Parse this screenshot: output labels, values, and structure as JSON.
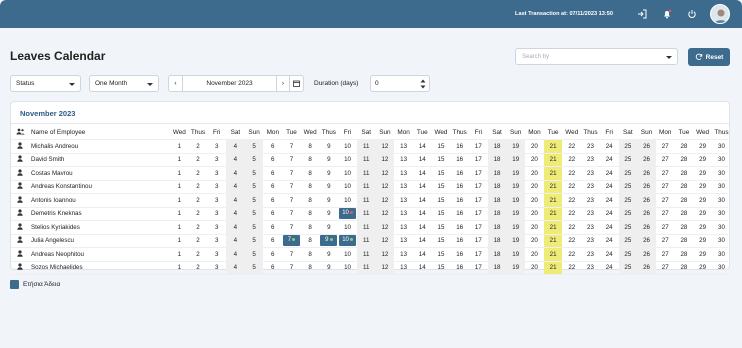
{
  "header": {
    "last_transaction": "Last Transaction at: 07/11/2023 13:50",
    "bg_color": "#3d6b8d"
  },
  "page": {
    "title": "Leaves Calendar"
  },
  "search": {
    "placeholder": "Search by"
  },
  "reset_label": "Reset",
  "filters": {
    "status": "Status",
    "period": "One Month",
    "month": "November 2023",
    "duration_label": "Duration (days)",
    "duration_value": "0"
  },
  "calendar": {
    "title": "November 2023",
    "name_header": "Name of Employee",
    "weekdays": [
      "Wed",
      "Thus",
      "Fri",
      "Sat",
      "Sun",
      "Mon",
      "Tue",
      "Wed",
      "Thus",
      "Fri",
      "Sat",
      "Sun",
      "Mon",
      "Tue",
      "Wed",
      "Thus",
      "Fri",
      "Sat",
      "Sun",
      "Mon",
      "Tue",
      "Wed",
      "Thus",
      "Fri",
      "Sat",
      "Sun",
      "Mon",
      "Tue",
      "Wed",
      "Thus"
    ],
    "weekend_days": [
      4,
      5,
      11,
      12,
      18,
      19,
      25,
      26
    ],
    "today": 21,
    "employees": [
      {
        "name": "Michalis Andreou",
        "leaves": []
      },
      {
        "name": "David Smith",
        "leaves": []
      },
      {
        "name": "Costas Mavrou",
        "leaves": []
      },
      {
        "name": "Andreas Konstantinou",
        "leaves": []
      },
      {
        "name": "Antonis Ioannou",
        "leaves": []
      },
      {
        "name": "Demetris Kneknas",
        "leaves": [
          {
            "day": 10,
            "dot": "#e05a5a"
          }
        ]
      },
      {
        "name": "Stelios Kyriakides",
        "leaves": []
      },
      {
        "name": "Julia Angelescu",
        "leaves": [
          {
            "day": 7,
            "dot": "#7fd37a"
          },
          {
            "day": 9,
            "dot": "#7fd37a"
          },
          {
            "day": 10,
            "dot": "#7fd37a"
          }
        ]
      },
      {
        "name": "Andreas Neophitou",
        "leaves": []
      },
      {
        "name": "Sozos Michaelides",
        "leaves": []
      }
    ]
  },
  "legend": {
    "label": "Ετήσια Άδεια",
    "color": "#3d6b8d"
  }
}
